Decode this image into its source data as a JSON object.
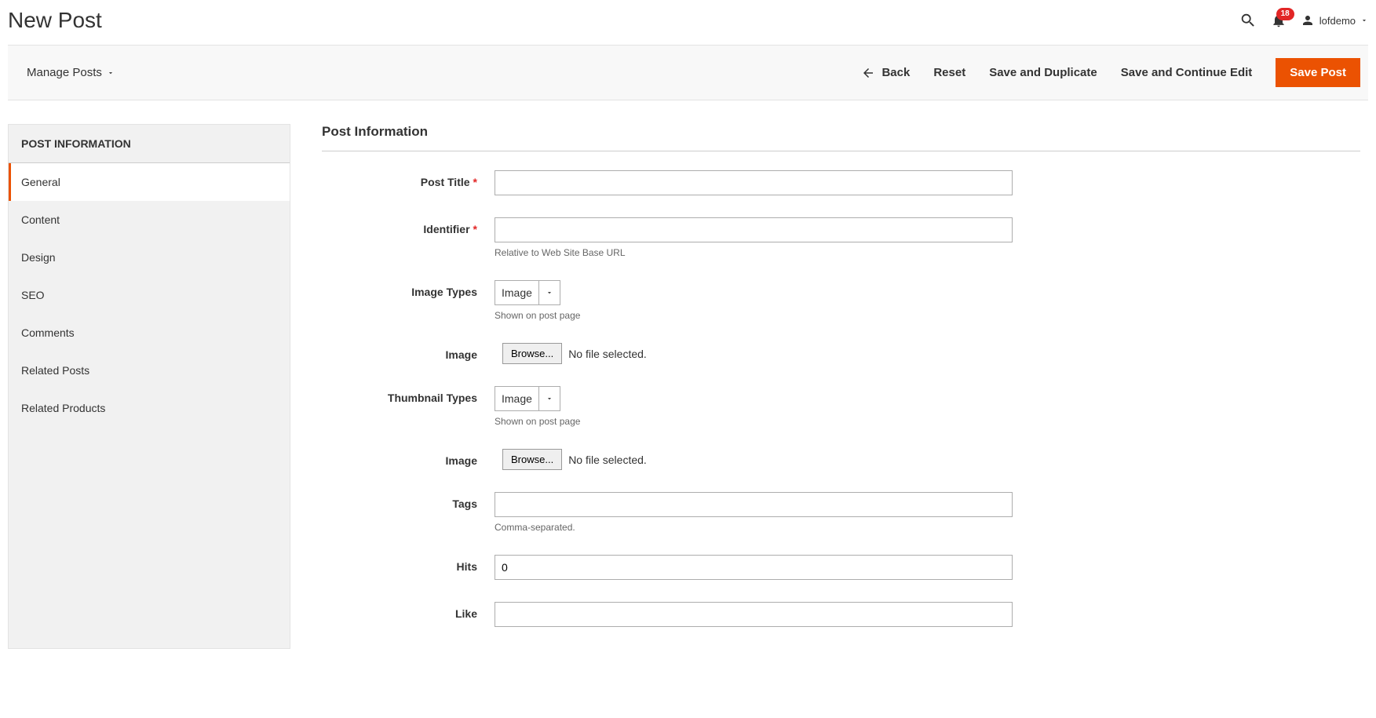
{
  "header": {
    "title": "New Post",
    "notification_count": "18",
    "username": "lofdemo"
  },
  "toolbar": {
    "manage_label": "Manage Posts",
    "back_label": "Back",
    "reset_label": "Reset",
    "save_duplicate_label": "Save and Duplicate",
    "save_continue_label": "Save and Continue Edit",
    "save_post_label": "Save Post"
  },
  "sidebar": {
    "header": "POST INFORMATION",
    "items": [
      {
        "label": "General",
        "active": true
      },
      {
        "label": "Content"
      },
      {
        "label": "Design"
      },
      {
        "label": "SEO"
      },
      {
        "label": "Comments"
      },
      {
        "label": "Related Posts"
      },
      {
        "label": "Related Products"
      }
    ]
  },
  "form": {
    "title": "Post Information",
    "fields": {
      "post_title": {
        "label": "Post Title",
        "value": ""
      },
      "identifier": {
        "label": "Identifier",
        "value": "",
        "note": "Relative to Web Site Base URL"
      },
      "image_types": {
        "label": "Image Types",
        "value": "Image",
        "note": "Shown on post page"
      },
      "image": {
        "label": "Image",
        "browse": "Browse...",
        "status": "No file selected."
      },
      "thumbnail_types": {
        "label": "Thumbnail Types",
        "value": "Image",
        "note": "Shown on post page"
      },
      "thumbnail_image": {
        "label": "Image",
        "browse": "Browse...",
        "status": "No file selected."
      },
      "tags": {
        "label": "Tags",
        "value": "",
        "note": "Comma-separated."
      },
      "hits": {
        "label": "Hits",
        "value": "0"
      },
      "like": {
        "label": "Like",
        "value": ""
      }
    }
  }
}
